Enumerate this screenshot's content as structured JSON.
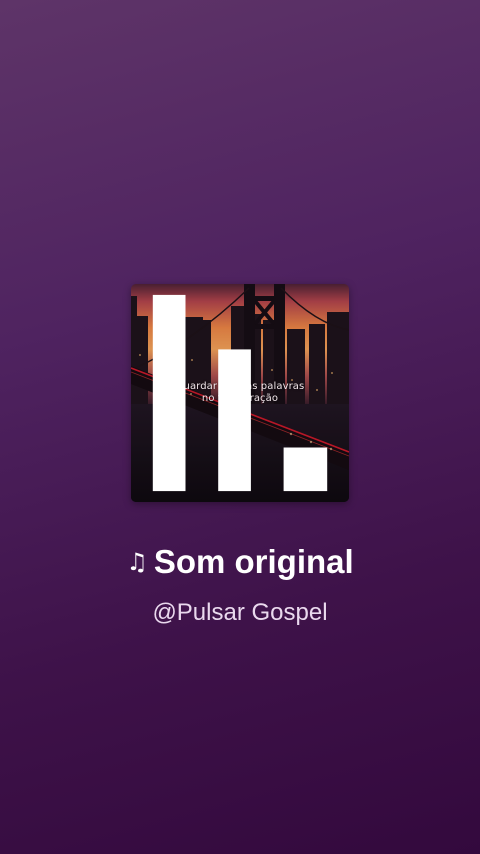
{
  "sound": {
    "title": "Som original",
    "author": "@Pulsar Gospel",
    "title_icon": "music-note-icon"
  },
  "cover": {
    "caption_line1": "Guardar minhas palavras",
    "caption_line2": "no teu coração",
    "logo_icon": "brand-logo-icon",
    "sky_top_color": "#4d2234",
    "sky_glow_color": "#f0924a"
  },
  "background": {
    "top_color": "#5e3468",
    "bottom_color": "#33093d"
  }
}
